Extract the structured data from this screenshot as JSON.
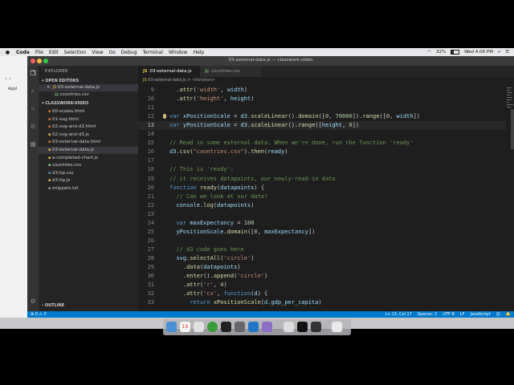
{
  "menubar": {
    "app": "Code",
    "items": [
      "File",
      "Edit",
      "Selection",
      "View",
      "Go",
      "Debug",
      "Terminal",
      "Window",
      "Help"
    ],
    "battery": "32%",
    "battery_level": 0.32,
    "day_time": "Wed 4:06 PM"
  },
  "window": {
    "title": "03-external-data.js — classwork-video"
  },
  "background_app": {
    "label": "Appl"
  },
  "sidebar": {
    "header": "EXPLORER",
    "open_editors_label": "OPEN EDITORS",
    "open_editors": [
      {
        "name": "03-external-data.js",
        "dir": "",
        "active": true,
        "close": "×"
      },
      {
        "name": "countries.csv",
        "dir": "",
        "active": false,
        "close": ""
      }
    ],
    "folder_label": "CLASSWORK-VIDEO",
    "files": [
      "00-scales.html",
      "01-svg.html",
      "02-svg-and-d3.html",
      "02-svg-and-d3.js",
      "03-external-data.html",
      "03-external-data.js",
      "a-completed-chart.js",
      "countries.csv",
      "d3-tip.css",
      "d3-tip.js",
      "snippets.txt"
    ],
    "active_file_index": 5,
    "outline_label": "OUTLINE"
  },
  "tabs": [
    {
      "label": "03-external-data.js",
      "type": "JS",
      "active": true
    },
    {
      "label": "countries.csv",
      "type": "csv",
      "active": false
    }
  ],
  "breadcrumb": {
    "file": "03-external-data.js",
    "separator": ">",
    "symbol": "<function>"
  },
  "editor": {
    "current_line": 13,
    "lines": [
      {
        "n": "9",
        "html": "  .<span class='fn'>attr</span>(<span class='str'>'width'</span>, <span class='var'>width</span>)"
      },
      {
        "n": "10",
        "html": "  .<span class='fn'>attr</span>(<span class='str'>'height'</span>, <span class='var'>height</span>)"
      },
      {
        "n": "11",
        "html": ""
      },
      {
        "n": "12",
        "html": "<span class='kw'>var</span> <span class='var'>xPositionScale</span> = <span class='var'>d3</span>.<span class='fn'>scaleLinear</span>().<span class='fn'>domain</span>([<span class='num'>0</span>, <span class='num'>70000</span>]).<span class='fn'>range</span>([<span class='num'>0</span>, <span class='var'>width</span>])"
      },
      {
        "n": "13",
        "html": "<span class='kw'>var</span> <span class='var'>yPositionScale</span> = <span class='var'>d3</span>.<span class='fn'>scaleLinear</span>().<span class='fn'>range</span>([<span class='var'>height</span>, <span class='num'>0</span>])"
      },
      {
        "n": "14",
        "html": ""
      },
      {
        "n": "15",
        "html": "<span class='cm'>// Read in some external data. When we're done, run the function 'ready'</span>"
      },
      {
        "n": "16",
        "html": "<span class='var'>d3</span>.<span class='fn'>csv</span>(<span class='str'>\"countries.csv\"</span>).<span class='fn'>then</span>(<span class='var'>ready</span>)"
      },
      {
        "n": "17",
        "html": ""
      },
      {
        "n": "18",
        "html": "<span class='cm'>// This is 'ready':</span>"
      },
      {
        "n": "19",
        "html": "<span class='cm'>// it receives datapoints, our newly-read-in data</span>"
      },
      {
        "n": "20",
        "html": "<span class='kw'>function</span> <span class='fn'>ready</span>(<span class='var'>datapoints</span>) {"
      },
      {
        "n": "21",
        "html": "  <span class='cm'>// Can we look at our data?</span>"
      },
      {
        "n": "22",
        "html": "  <span class='var'>console</span>.<span class='fn'>log</span>(<span class='var'>datapoints</span>)"
      },
      {
        "n": "23",
        "html": ""
      },
      {
        "n": "24",
        "html": "  <span class='kw'>var</span> <span class='var'>maxExpectancy</span> = <span class='num'>100</span>"
      },
      {
        "n": "25",
        "html": "  <span class='var'>yPositionScale</span>.<span class='fn'>domain</span>([<span class='num'>0</span>, <span class='var'>maxExpectancy</span>])"
      },
      {
        "n": "26",
        "html": ""
      },
      {
        "n": "27",
        "html": "  <span class='cm'>// d3 code goes here</span>"
      },
      {
        "n": "28",
        "html": "  <span class='var'>svg</span>.<span class='fn'>selectAll</span>(<span class='str'>'circle'</span>)"
      },
      {
        "n": "29",
        "html": "    .<span class='fn'>data</span>(<span class='var'>datapoints</span>)"
      },
      {
        "n": "30",
        "html": "    .<span class='fn'>enter</span>().<span class='fn'>append</span>(<span class='str'>'circle'</span>)"
      },
      {
        "n": "31",
        "html": "    .<span class='fn'>attr</span>(<span class='str'>'r'</span>, <span class='num'>4</span>)"
      },
      {
        "n": "32",
        "html": "    .<span class='fn'>attr</span>(<span class='str'>'cx'</span>, <span class='kw'>function</span>(<span class='var'>d</span>) {"
      },
      {
        "n": "33",
        "html": "      <span class='kw'>return</span> <span class='fn'>xPositionScale</span>(<span class='var'>d</span>.<span class='var'>gdp_per_capita</span>)"
      }
    ]
  },
  "statusbar": {
    "problems": "⊗ 0  ⚠ 0",
    "position": "Ln 13, Col 17",
    "spaces": "Spaces: 2",
    "encoding": "UTF-8",
    "eol": "LF",
    "language": "JavaScript",
    "feedback": "☺",
    "bell": "🔔"
  },
  "dock": {
    "calendar_day": "19"
  },
  "colors": {
    "status_bar": "#007acc",
    "editor_bg": "#1e1e1e",
    "sidebar_bg": "#252526"
  }
}
